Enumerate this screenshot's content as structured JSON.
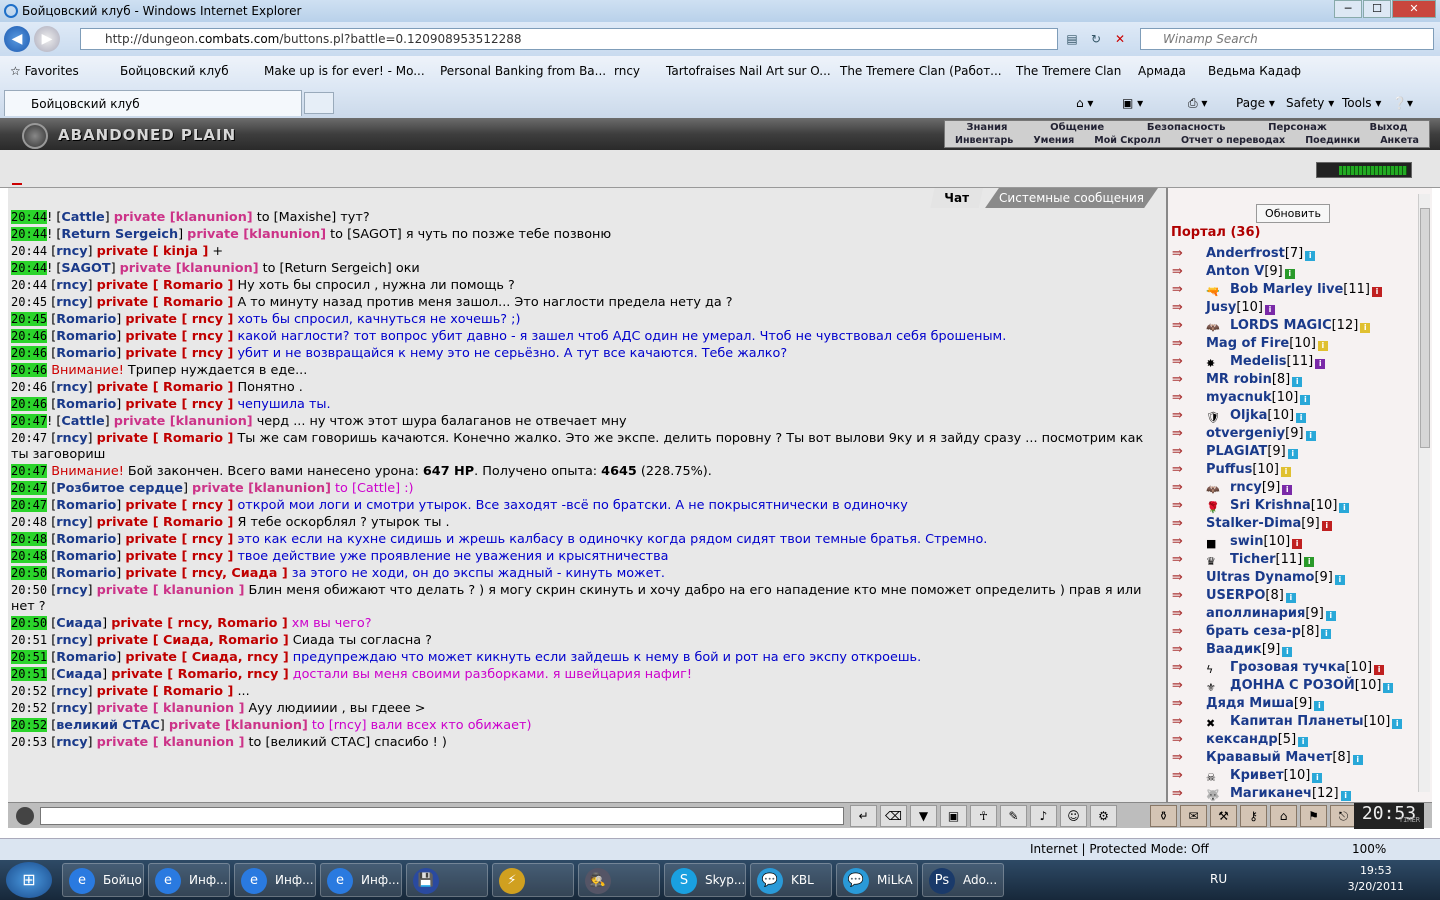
{
  "window": {
    "title": "Бойцовский клуб - Windows Internet Explorer",
    "min": "─",
    "max": "☐",
    "close": "✕"
  },
  "addressbar": {
    "url_prefix": "http://dungeon.",
    "url_host": "combats.com",
    "url_rest": "/buttons.pl?battle=0.120908953512288",
    "search_placeholder": "Winamp Search"
  },
  "favorites": [
    "Favorites",
    "Бойцовский клуб",
    "Make up is for ever! - Mo...",
    "Personal Banking from Ba...",
    "rncy",
    "Tartofraises  Nail Art sur O...",
    "The Tremere Clan (Работ...",
    "The Tremere Clan",
    "Армада",
    "Ведьма Кадаф"
  ],
  "tab": {
    "label": "Бойцовский клуб"
  },
  "commandbar": {
    "page": "Page",
    "safety": "Safety",
    "tools": "Tools"
  },
  "game": {
    "logo": "ABANDONED PLAIN",
    "menu_row1": [
      "Знания",
      "Общение",
      "Безопасность",
      "Персонаж",
      "Выход"
    ],
    "menu_row2": [
      "Инвентарь",
      "Умения",
      "Мой Скролл",
      "Отчет о переводах",
      "Поединки",
      "Анкета"
    ]
  },
  "chat": {
    "tabs": [
      "Чат",
      "Системные сообщения"
    ],
    "messages": [
      {
        "time": "20:44",
        "hl": true,
        "parts": [
          [
            "plain",
            "! ["
          ],
          [
            "nick",
            "Cattle"
          ],
          [
            "plain",
            "] "
          ],
          [
            "privclan",
            "private [klanunion]"
          ],
          [
            "plain",
            " to [Maxishe] тут?"
          ]
        ]
      },
      {
        "time": "20:44",
        "hl": true,
        "parts": [
          [
            "plain",
            "! ["
          ],
          [
            "nick",
            "Return Sergeich"
          ],
          [
            "plain",
            "] "
          ],
          [
            "privclan",
            "private [klanunion]"
          ],
          [
            "plain",
            " to [SAGOT] я чуть по позже тебе позвоню"
          ]
        ]
      },
      {
        "time": "20:44",
        "hl": false,
        "parts": [
          [
            "plain",
            " ["
          ],
          [
            "nick",
            "rncy"
          ],
          [
            "plain",
            "] "
          ],
          [
            "priv",
            "private [ kinja ]"
          ],
          [
            "plain",
            " +"
          ]
        ]
      },
      {
        "time": "20:44",
        "hl": true,
        "parts": [
          [
            "plain",
            "! ["
          ],
          [
            "nick",
            "SAGOT"
          ],
          [
            "plain",
            "] "
          ],
          [
            "privclan",
            "private [klanunion]"
          ],
          [
            "plain",
            " to [Return Sergeich] оки"
          ]
        ]
      },
      {
        "time": "20:44",
        "hl": false,
        "parts": [
          [
            "plain",
            " ["
          ],
          [
            "nick",
            "rncy"
          ],
          [
            "plain",
            "] "
          ],
          [
            "priv",
            "private [ Romario ]"
          ],
          [
            "plain",
            " Ну хоть бы спросил , нужна ли помощь ?"
          ]
        ]
      },
      {
        "time": "20:45",
        "hl": false,
        "parts": [
          [
            "plain",
            " ["
          ],
          [
            "nick",
            "rncy"
          ],
          [
            "plain",
            "] "
          ],
          [
            "priv",
            "private [ Romario ]"
          ],
          [
            "plain",
            " А то минуту назад против меня зашол... Это наглости предела нету да ?"
          ]
        ]
      },
      {
        "time": "20:45",
        "hl": true,
        "parts": [
          [
            "plain",
            " ["
          ],
          [
            "nick",
            "Romario"
          ],
          [
            "plain",
            "] "
          ],
          [
            "priv",
            "private [ rncy ]"
          ],
          [
            "blue",
            " хоть бы спросил, качнуться не хочешь? ;)"
          ]
        ]
      },
      {
        "time": "20:46",
        "hl": true,
        "parts": [
          [
            "plain",
            " ["
          ],
          [
            "nick",
            "Romario"
          ],
          [
            "plain",
            "] "
          ],
          [
            "priv",
            "private [ rncy ]"
          ],
          [
            "blue",
            " какой наглости? тот вопрос убит давно - я зашел чтоб АДС один не умерал. Чтоб не чувствовал себя брошеным."
          ]
        ]
      },
      {
        "time": "20:46",
        "hl": true,
        "parts": [
          [
            "plain",
            " ["
          ],
          [
            "nick",
            "Romario"
          ],
          [
            "plain",
            "] "
          ],
          [
            "priv",
            "private [ rncy ]"
          ],
          [
            "blue",
            " убит и не возвращайся к нему это не серьёзно. А тут все качаются. Тебе жалко?"
          ]
        ]
      },
      {
        "time": "20:46",
        "hl": true,
        "parts": [
          [
            "warn",
            " Внимание!"
          ],
          [
            "plain",
            " Трипер нуждается в еде..."
          ]
        ]
      },
      {
        "time": "20:46",
        "hl": false,
        "parts": [
          [
            "plain",
            " ["
          ],
          [
            "nick",
            "rncy"
          ],
          [
            "plain",
            "] "
          ],
          [
            "priv",
            "private [ Romario ]"
          ],
          [
            "plain",
            " Понятно ."
          ]
        ]
      },
      {
        "time": "20:46",
        "hl": true,
        "parts": [
          [
            "plain",
            " ["
          ],
          [
            "nick",
            "Romario"
          ],
          [
            "plain",
            "] "
          ],
          [
            "priv",
            "private [ rncy ]"
          ],
          [
            "blue",
            " чепушила ты."
          ]
        ]
      },
      {
        "time": "20:47",
        "hl": true,
        "parts": [
          [
            "plain",
            "! ["
          ],
          [
            "nick",
            "Cattle"
          ],
          [
            "plain",
            "] "
          ],
          [
            "privclan",
            "private [klanunion]"
          ],
          [
            "plain",
            " черд ... ну чтож этот шура балаганов не отвечает мну"
          ]
        ]
      },
      {
        "time": "20:47",
        "hl": false,
        "parts": [
          [
            "plain",
            " ["
          ],
          [
            "nick",
            "rncy"
          ],
          [
            "plain",
            "] "
          ],
          [
            "priv",
            "private [ Romario ]"
          ],
          [
            "plain",
            " Ты же сам говоришь качаются. Конечно жалко. Это же экспе. делить поровну ? Ты вот вылови 9ку и я зайду сразу ... посмотрим как ты заговориш"
          ]
        ]
      },
      {
        "time": "20:47",
        "hl": true,
        "parts": [
          [
            "warn",
            " Внимание!"
          ],
          [
            "plain",
            " Бой закончен. Всего вами нанесено урона: "
          ],
          [
            "bold",
            "647 HP"
          ],
          [
            "plain",
            ". Получено опыта: "
          ],
          [
            "bold",
            "4645"
          ],
          [
            "plain",
            " (228.75%)."
          ]
        ]
      },
      {
        "time": "20:47",
        "hl": true,
        "parts": [
          [
            "plain",
            " ["
          ],
          [
            "nick",
            "Розбитое сердце"
          ],
          [
            "plain",
            "] "
          ],
          [
            "privclan",
            "private [klanunion]"
          ],
          [
            "mag",
            " to [Cattle] :)"
          ]
        ]
      },
      {
        "time": "20:47",
        "hl": true,
        "parts": [
          [
            "plain",
            " ["
          ],
          [
            "nick",
            "Romario"
          ],
          [
            "plain",
            "] "
          ],
          [
            "priv",
            "private [ rncy ]"
          ],
          [
            "blue",
            " открой мои логи и смотри утырок. Все заходят -всё по братски. А не покрысятнически в одиночку"
          ]
        ]
      },
      {
        "time": "20:48",
        "hl": false,
        "parts": [
          [
            "plain",
            " ["
          ],
          [
            "nick",
            "rncy"
          ],
          [
            "plain",
            "] "
          ],
          [
            "priv",
            "private [ Romario ]"
          ],
          [
            "plain",
            " Я тебе оскорблял ? утырок ты ."
          ]
        ]
      },
      {
        "time": "20:48",
        "hl": true,
        "parts": [
          [
            "plain",
            " ["
          ],
          [
            "nick",
            "Romario"
          ],
          [
            "plain",
            "] "
          ],
          [
            "priv",
            "private [ rncy ]"
          ],
          [
            "blue",
            " это как если на кухне сидишь и жрешь калбасу в одиночку когда рядом сидят твои темные братья. Стремно."
          ]
        ]
      },
      {
        "time": "20:48",
        "hl": true,
        "parts": [
          [
            "plain",
            " ["
          ],
          [
            "nick",
            "Romario"
          ],
          [
            "plain",
            "] "
          ],
          [
            "priv",
            "private [ rncy ]"
          ],
          [
            "blue",
            " твое действие уже проявление не уважения и крысятничества"
          ]
        ]
      },
      {
        "time": "20:50",
        "hl": true,
        "parts": [
          [
            "plain",
            " ["
          ],
          [
            "nick",
            "Romario"
          ],
          [
            "plain",
            "] "
          ],
          [
            "priv",
            "private [ rncy, Сиада ]"
          ],
          [
            "blue",
            " за этого не ходи, он до экспы жадный - кинуть может."
          ]
        ]
      },
      {
        "time": "20:50",
        "hl": false,
        "parts": [
          [
            "plain",
            " ["
          ],
          [
            "nick",
            "rncy"
          ],
          [
            "plain",
            "] "
          ],
          [
            "privclan",
            "private [ klanunion ]"
          ],
          [
            "plain",
            " Блин меня обижают что делать ? ) я могу скрин скинуть и хочу дабро на его нападение кто мне поможет определить ) прав я или нет ?"
          ]
        ]
      },
      {
        "time": "20:50",
        "hl": true,
        "parts": [
          [
            "plain",
            " ["
          ],
          [
            "nick",
            "Сиада"
          ],
          [
            "plain",
            "] "
          ],
          [
            "priv",
            "private [ rncy, Romario ]"
          ],
          [
            "mag",
            " хм вы чего?"
          ]
        ]
      },
      {
        "time": "20:51",
        "hl": false,
        "parts": [
          [
            "plain",
            " ["
          ],
          [
            "nick",
            "rncy"
          ],
          [
            "plain",
            "] "
          ],
          [
            "priv",
            "private [ Сиада, Romario ]"
          ],
          [
            "plain",
            " Сиада ты согласна ?"
          ]
        ]
      },
      {
        "time": "20:51",
        "hl": true,
        "parts": [
          [
            "plain",
            " ["
          ],
          [
            "nick",
            "Romario"
          ],
          [
            "plain",
            "] "
          ],
          [
            "priv",
            "private [ Сиада, rncy ]"
          ],
          [
            "blue",
            " предупреждаю что может кикнуть если зайдешь к нему в бой и рот на его экспу откроешь."
          ]
        ]
      },
      {
        "time": "20:51",
        "hl": true,
        "parts": [
          [
            "plain",
            " ["
          ],
          [
            "nick",
            "Сиада"
          ],
          [
            "plain",
            "] "
          ],
          [
            "priv",
            "private [ Romario, rncy ]"
          ],
          [
            "mag",
            " достали вы меня своими разборками. я швейцария нафиг!"
          ]
        ]
      },
      {
        "time": "20:52",
        "hl": false,
        "parts": [
          [
            "plain",
            " ["
          ],
          [
            "nick",
            "rncy"
          ],
          [
            "plain",
            "] "
          ],
          [
            "priv",
            "private [ Romario ]"
          ],
          [
            "plain",
            " ..."
          ]
        ]
      },
      {
        "time": "20:52",
        "hl": false,
        "parts": [
          [
            "plain",
            " ["
          ],
          [
            "nick",
            "rncy"
          ],
          [
            "plain",
            "] "
          ],
          [
            "privclan",
            "private [ klanunion ]"
          ],
          [
            "plain",
            " Ауу людииии , вы гдеее >"
          ]
        ]
      },
      {
        "time": "20:52",
        "hl": true,
        "parts": [
          [
            "plain",
            " ["
          ],
          [
            "nick",
            "великий СТАС"
          ],
          [
            "plain",
            "] "
          ],
          [
            "privclan",
            "private [klanunion]"
          ],
          [
            "mag",
            " to [rncy] вали всех кто обижает)"
          ]
        ]
      },
      {
        "time": "20:53",
        "hl": false,
        "parts": [
          [
            "plain",
            " ["
          ],
          [
            "nick",
            "rncy"
          ],
          [
            "plain",
            "] "
          ],
          [
            "privclan",
            "private [ klanunion ]"
          ],
          [
            "plain",
            " to [великий СТАС] спасибо ! )"
          ]
        ]
      }
    ]
  },
  "sidebar": {
    "refresh_label": "Обновить",
    "portal_label": "Портал (36)",
    "users": [
      {
        "name": "Anderfrost",
        "lvl": "[7]",
        "info": "i1",
        "emb": ""
      },
      {
        "name": "Anton V",
        "lvl": "[9]",
        "info": "i2",
        "emb": ""
      },
      {
        "name": "Bob Marley live",
        "lvl": "[11]",
        "info": "i5",
        "emb": "🔫"
      },
      {
        "name": "Jusy",
        "lvl": "[10]",
        "info": "i3",
        "emb": ""
      },
      {
        "name": "LORDS MAGIC",
        "lvl": "[12]",
        "info": "i4",
        "emb": "🦇"
      },
      {
        "name": "Mag of Fire",
        "lvl": "[10]",
        "info": "i4",
        "emb": ""
      },
      {
        "name": "Medelis",
        "lvl": "[11]",
        "info": "i3",
        "emb": "✸"
      },
      {
        "name": "MR robin",
        "lvl": "[8]",
        "info": "i1",
        "emb": ""
      },
      {
        "name": "myacnuk",
        "lvl": "[10]",
        "info": "i1",
        "emb": ""
      },
      {
        "name": "Oljka",
        "lvl": "[10]",
        "info": "i1",
        "emb": "🛡"
      },
      {
        "name": "otvergeniy",
        "lvl": "[9]",
        "info": "i1",
        "emb": ""
      },
      {
        "name": "PLAGIAT",
        "lvl": "[9]",
        "info": "i1",
        "emb": ""
      },
      {
        "name": "Puffus",
        "lvl": "[10]",
        "info": "i4",
        "emb": ""
      },
      {
        "name": "rncy",
        "lvl": "[9]",
        "info": "i3",
        "emb": "🦇"
      },
      {
        "name": "Sri Krishna",
        "lvl": "[10]",
        "info": "i1",
        "emb": "🌹"
      },
      {
        "name": "Stalker-Dima",
        "lvl": "[9]",
        "info": "i5",
        "emb": ""
      },
      {
        "name": "swin",
        "lvl": "[10]",
        "info": "i5",
        "emb": "■"
      },
      {
        "name": "Ticher",
        "lvl": "[11]",
        "info": "i2",
        "emb": "♛"
      },
      {
        "name": "Ultras Dynamo",
        "lvl": "[9]",
        "info": "i1",
        "emb": ""
      },
      {
        "name": "USERPO",
        "lvl": "[8]",
        "info": "i1",
        "emb": ""
      },
      {
        "name": "аполлинария",
        "lvl": "[9]",
        "info": "i1",
        "emb": ""
      },
      {
        "name": "брать сеза-р",
        "lvl": "[8]",
        "info": "i1",
        "emb": ""
      },
      {
        "name": "Ваадик",
        "lvl": "[9]",
        "info": "i1",
        "emb": ""
      },
      {
        "name": "Грозовая тучка",
        "lvl": "[10]",
        "info": "i5",
        "emb": "ϟ"
      },
      {
        "name": "ДОННА С РОЗОЙ",
        "lvl": "[10]",
        "info": "i1",
        "emb": "⚜"
      },
      {
        "name": "Дядя Миша",
        "lvl": "[9]",
        "info": "i1",
        "emb": ""
      },
      {
        "name": "Капитан Планеты",
        "lvl": "[10]",
        "info": "i1",
        "emb": "✖"
      },
      {
        "name": "кександр",
        "lvl": "[5]",
        "info": "i1",
        "emb": ""
      },
      {
        "name": "Крававый Мачет",
        "lvl": "[8]",
        "info": "i1",
        "emb": ""
      },
      {
        "name": "Кривет",
        "lvl": "[10]",
        "info": "i1",
        "emb": "☠"
      },
      {
        "name": "Магиканеч",
        "lvl": "[12]",
        "info": "i1",
        "emb": "🐺"
      }
    ]
  },
  "bottombar": {
    "clock": "20:53",
    "clock_sub": "TIMER"
  },
  "statusbar": {
    "zone": "Internet | Protected Mode: Off",
    "zoom": "100%"
  },
  "taskbar": {
    "items": [
      {
        "label": "Бойцо...",
        "icon": "e"
      },
      {
        "label": "Инф...",
        "icon": "e"
      },
      {
        "label": "Инф...",
        "icon": "e"
      },
      {
        "label": "Инф...",
        "icon": "e"
      },
      {
        "label": "",
        "icon": "💾"
      },
      {
        "label": "",
        "icon": "⚡"
      },
      {
        "label": "",
        "icon": "🕵"
      },
      {
        "label": "Skyp...",
        "icon": "S"
      },
      {
        "label": "KBL",
        "icon": "💬"
      },
      {
        "label": "MiLkA",
        "icon": "💬"
      },
      {
        "label": "Ado...",
        "icon": "Ps"
      }
    ],
    "lang": "RU",
    "time": "19:53",
    "date": "3/20/2011"
  }
}
